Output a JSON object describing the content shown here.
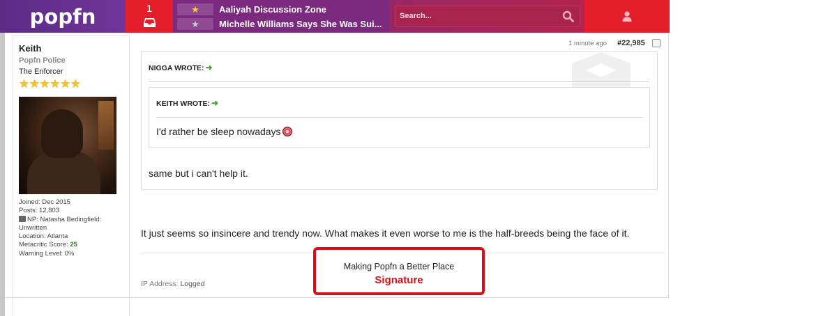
{
  "header": {
    "logo": "popfn",
    "alert_count": "1",
    "threads": [
      {
        "title": "Aaliyah Discussion Zone",
        "star_color": "#f5d431"
      },
      {
        "title": "Michelle Williams Says She Was Sui...",
        "star_color": "#c9c9cf"
      }
    ],
    "search_placeholder": "Search..."
  },
  "user": {
    "name": "Keith",
    "rank": "Popfn Police",
    "title": "The Enforcer",
    "stars": "★★★★★★",
    "stats": {
      "joined": "Joined: Dec 2015",
      "posts": "Posts: 12,803",
      "np": "NP: Natasha Bedingfield: Unwritten",
      "location": "Location: Atlanta",
      "metacritic_label": "Metacritic Score: ",
      "metacritic_value": "25",
      "warning": "Warning Level: 0%"
    }
  },
  "post": {
    "time": "1 minute ago",
    "number": "#22,985",
    "quote_outer_author": "NIGGA WROTE:",
    "quote_inner_author": "KEITH WROTE:",
    "quote_inner_text": "I'd rather be sleep nowadays",
    "quote_outer_text": "same but i can't help it.",
    "body": "It just seems so insincere and trendy now. What makes it even worse to me is the half-breeds being the face of it.",
    "ip_label": "IP Address: ",
    "ip_value": "Logged",
    "signature_text": "Making Popfn a Better Place",
    "signature_label": "Signature"
  },
  "colors": {
    "brand_purple": "#5c2b86",
    "alert_red": "#e51e2c",
    "signature_red": "#d81018",
    "score_green": "#2e7d1f"
  }
}
